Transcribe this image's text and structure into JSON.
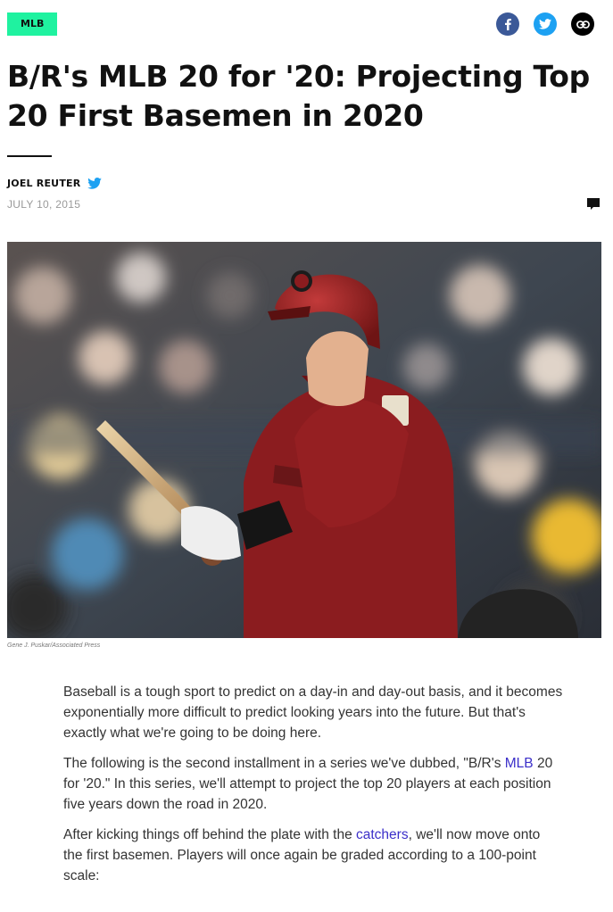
{
  "category": {
    "label": "MLB"
  },
  "share": {
    "facebook_icon": "facebook-icon",
    "twitter_icon": "twitter-icon",
    "link_icon": "link-icon"
  },
  "article": {
    "title": "B/R's MLB 20 for '20: Projecting Top 20 First Basemen in 2020",
    "author": "JOEL REUTER",
    "date": "JULY 10, 2015",
    "image": {
      "description": "Arizona Diamondbacks first baseman in red batting helmet holding bat",
      "caption": "Gene J. Puskar/Associated Press"
    },
    "paragraphs": {
      "p1": "Baseball is a tough sport to predict on a day-in and day-out basis, and it becomes exponentially more difficult to predict looking years into the future. But that's exactly what we're going to be doing here.",
      "p2_before": "The following is the second installment in a series we've dubbed, \"B/R's ",
      "p2_link": "MLB",
      "p2_after": " 20 for '20.\" In this series, we'll attempt to project the top 20 players at each position five years down the road in 2020.",
      "p3_before": "After kicking things off behind the plate with the ",
      "p3_link": "catchers",
      "p3_after": ", we'll now move onto the first basemen. Players will once again be graded according to a 100-point scale:"
    }
  },
  "colors": {
    "tag": "#1ff2a0",
    "facebook": "#3b5998",
    "twitter": "#1da1f2",
    "link": "#3b2fc9"
  }
}
